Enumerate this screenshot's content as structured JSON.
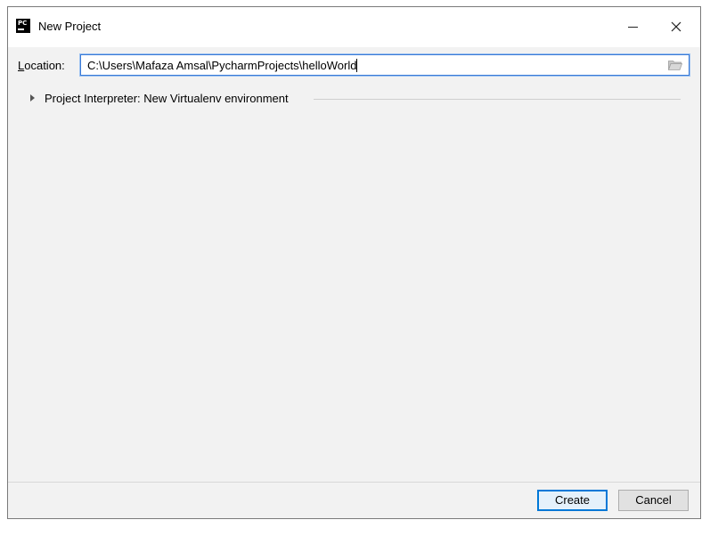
{
  "window": {
    "title": "New Project",
    "app_icon_text": "PC"
  },
  "location": {
    "label": "Location:",
    "mnemonic": "L",
    "label_rest": "ocation:",
    "value": "C:\\Users\\Mafaza Amsal\\PycharmProjects\\helloWorld"
  },
  "interpreter": {
    "label": "Project Interpreter: New Virtualenv environment",
    "expanded": false
  },
  "buttons": {
    "create": "Create",
    "cancel": "Cancel"
  },
  "colors": {
    "accent": "#0078d7",
    "field_focus_border": "#3a7ad6",
    "dialog_background": "#f2f2f2"
  },
  "icons": {
    "app": "pycharm-icon",
    "minimize": "minimize-icon",
    "close": "close-icon",
    "browse": "folder-icon",
    "expand": "triangle-right-icon"
  }
}
